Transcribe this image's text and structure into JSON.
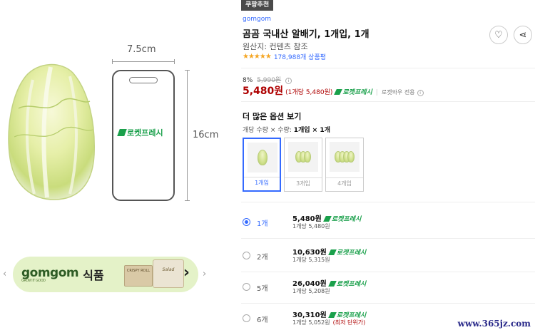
{
  "gallery": {
    "width_label": "7.5cm",
    "height_label": "16cm",
    "phone_logo": "로켓프레시",
    "banner": {
      "brand": "gomgom",
      "brand_sub": "GROW IT GOOD",
      "category": "식품",
      "pack1_text": "CRISPY ROLL",
      "pack2_text": "Salad",
      "prev_arrow": "‹",
      "next_arrow": "›",
      "chevron": "›"
    }
  },
  "product": {
    "badge": "쿠팡추천",
    "brand": "gomgom",
    "title": "곰곰 국내산 알배기, 1개입, 1개",
    "origin": "원산지: 컨텐츠 참조",
    "stars": "★★★★★",
    "rating_count": "178,988개 상품평"
  },
  "actions": {
    "heart_icon": "♡",
    "share_icon": "⋖"
  },
  "pricing": {
    "discount_pct": "8%",
    "original_price": "5,990원",
    "info": "i",
    "price": "5,480원",
    "unit_price": "(1개당 5,480원)",
    "rocket": "로켓프레시",
    "wow": "로켓와우 전용"
  },
  "options": {
    "section_title": "더 많은 옵션 보기",
    "label_prefix": "개당 수량 × 수량: ",
    "label_value": "1개입 × 1개",
    "thumbs": [
      {
        "label": "1개입",
        "selected": true
      },
      {
        "label": "3개입",
        "selected": false
      },
      {
        "label": "4개입",
        "selected": false
      }
    ],
    "rows": [
      {
        "qty": "1개",
        "price": "5,480원",
        "rocket": "로켓프레시",
        "unit": "1개당 5,480원",
        "note": "",
        "selected": true
      },
      {
        "qty": "2개",
        "price": "10,630원",
        "rocket": "로켓프레시",
        "unit": "1개당 5,315원",
        "note": "",
        "selected": false
      },
      {
        "qty": "5개",
        "price": "26,040원",
        "rocket": "로켓프레시",
        "unit": "1개당 5,208원",
        "note": "",
        "selected": false
      },
      {
        "qty": "6개",
        "price": "30,310원",
        "rocket": "로켓프레시",
        "unit": "1개당 5,052원",
        "note": "(최저 단위가)",
        "selected": false
      }
    ]
  },
  "watermark": "www.365jz.com",
  "colors": {
    "accent_blue": "#346aff",
    "price_red": "#ae0000",
    "rocket_green": "#1aa04b",
    "banner_bg": "#e4f2c8"
  }
}
